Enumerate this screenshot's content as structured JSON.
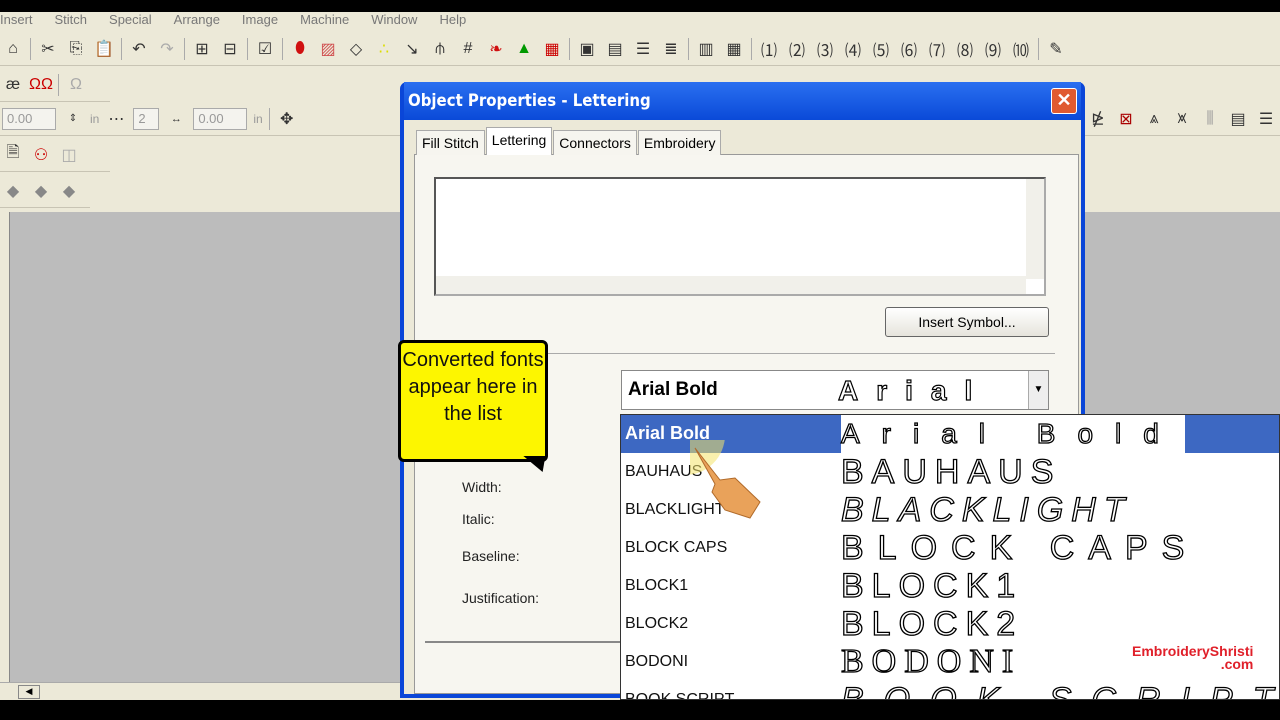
{
  "menu": [
    "Insert",
    "Stitch",
    "Special",
    "Arrange",
    "Image",
    "Machine",
    "Window",
    "Help"
  ],
  "toolbar": {
    "spin1": "0.00",
    "spin2": "2",
    "spin3": "0.00",
    "unit": "in"
  },
  "dialog": {
    "title": "Object Properties - Lettering",
    "tabs": [
      "Fill Stitch",
      "Lettering",
      "Connectors",
      "Embroidery"
    ],
    "active_tab": "Lettering",
    "text_value": "",
    "insert_symbol": "Insert Symbol...",
    "labels": {
      "width": "Width:",
      "italic": "Italic:",
      "baseline": "Baseline:",
      "justification": "Justification:"
    },
    "font_combo": {
      "value": "Arial Bold",
      "preview": "Arial"
    }
  },
  "font_list": [
    {
      "name": "Arial Bold",
      "preview": "Arial Bold",
      "selected": true
    },
    {
      "name": "BAUHAUS",
      "preview": "BAUHAUS"
    },
    {
      "name": "BLACKLIGHT",
      "preview": "BLACKLIGHT"
    },
    {
      "name": "BLOCK CAPS",
      "preview": "BLOCK CAPS"
    },
    {
      "name": "BLOCK1",
      "preview": "BLOCK1"
    },
    {
      "name": "BLOCK2",
      "preview": "BLOCK2"
    },
    {
      "name": "BODONI",
      "preview": "BODONI"
    },
    {
      "name": "BOOK SCRIPT",
      "preview": "BOOK SCRIPT"
    }
  ],
  "callout": "Converted fonts appear here in the list",
  "watermark": {
    "line1": "EmbroideryShristi",
    "line2": ".com"
  },
  "colors": {
    "titlebar": "#0a46d8",
    "selection": "#3d68c2",
    "callout": "#fdf600"
  }
}
